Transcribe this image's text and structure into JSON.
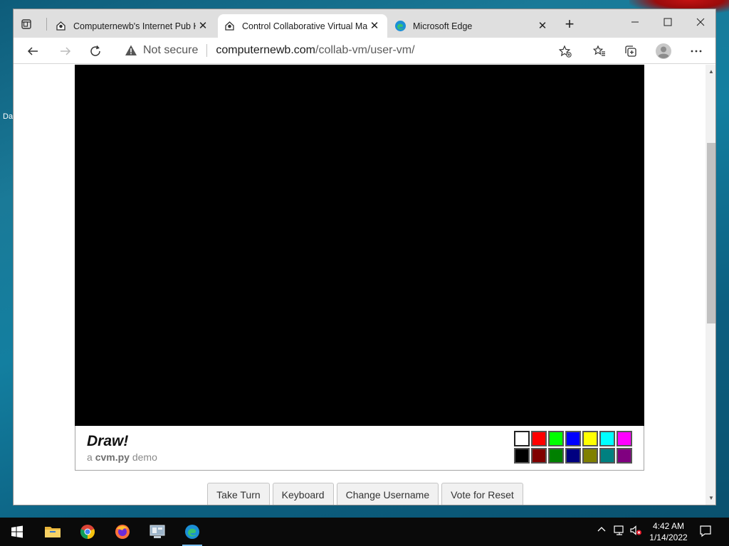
{
  "desktop": {
    "fragment_text": "Da"
  },
  "browser": {
    "tabs": [
      {
        "title": "Computernewb's Internet Pub H",
        "active": false
      },
      {
        "title": "Control Collaborative Virtual Ma",
        "active": true
      },
      {
        "title": "Microsoft Edge",
        "active": false
      }
    ],
    "security_label": "Not secure",
    "url_host": "computernewb.com",
    "url_path": "/collab-vm/user-vm/"
  },
  "vm": {
    "title": "Draw!",
    "subtitle_prefix": "a",
    "subtitle_brand": "cvm.py",
    "subtitle_suffix": "demo",
    "palette": [
      "#ffffff",
      "#ff0000",
      "#00ff00",
      "#0000ff",
      "#ffff00",
      "#00ffff",
      "#ff00ff",
      "#000000",
      "#800000",
      "#008000",
      "#000080",
      "#808000",
      "#008080",
      "#800080"
    ],
    "buttons": [
      "Take Turn",
      "Keyboard",
      "Change Username",
      "Vote for Reset"
    ]
  },
  "taskbar": {
    "apps": [
      "start",
      "file-explorer",
      "chrome",
      "firefox",
      "control-panel",
      "edge"
    ],
    "time": "4:42 AM",
    "date": "1/14/2022"
  }
}
